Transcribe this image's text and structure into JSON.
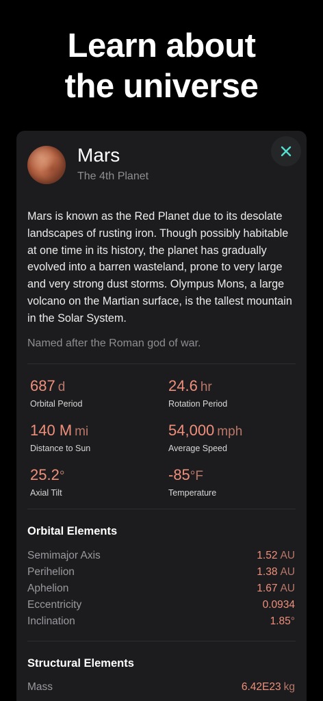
{
  "headline": {
    "line1": "Learn about",
    "line2": "the universe"
  },
  "card": {
    "title": "Mars",
    "subtitle": "The 4th Planet",
    "description": "Mars is known as the Red Planet due to its desolate landscapes of rusting iron. Though possibly habitable at one time in its history, the planet has gradually evolved into a barren wasteland, prone to very large and very strong dust storms. Olympus Mons, a large volcano on the Martian surface, is the tallest mountain in the Solar System.",
    "fact": "Named after the Roman god of war.",
    "icons": {
      "close": "close-icon",
      "planet": "mars-image"
    },
    "colors": {
      "accent": "#f0907c",
      "close_icon": "#54e0d0",
      "card_bg": "#1c1c1e"
    }
  },
  "stats": [
    {
      "value": "687",
      "unit": "d",
      "label": "Orbital Period"
    },
    {
      "value": "24.6",
      "unit": "hr",
      "label": "Rotation Period"
    },
    {
      "value": "140 M",
      "unit": "mi",
      "label": "Distance to Sun"
    },
    {
      "value": "54,000",
      "unit": "mph",
      "label": "Average Speed"
    },
    {
      "value": "25.2",
      "unit": "°",
      "label": "Axial Tilt"
    },
    {
      "value": "-85",
      "unit": "°F",
      "label": "Temperature"
    }
  ],
  "orbital": {
    "title": "Orbital Elements",
    "rows": [
      {
        "key": "Semimajor Axis",
        "value": "1.52",
        "unit": "AU"
      },
      {
        "key": "Perihelion",
        "value": "1.38",
        "unit": "AU"
      },
      {
        "key": "Aphelion",
        "value": "1.67",
        "unit": "AU"
      },
      {
        "key": "Eccentricity",
        "value": "0.0934",
        "unit": ""
      },
      {
        "key": "Inclination",
        "value": "1.85",
        "unit": "°"
      }
    ]
  },
  "structural": {
    "title": "Structural Elements",
    "rows": [
      {
        "key": "Mass",
        "value": "6.42E23",
        "unit": "kg"
      }
    ]
  }
}
